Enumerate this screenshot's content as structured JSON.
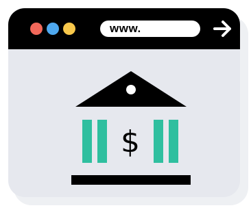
{
  "browser": {
    "url_text": "www.",
    "window_controls": [
      {
        "name": "close",
        "color": "#f2685a"
      },
      {
        "name": "minimize",
        "color": "#4fa9ef"
      },
      {
        "name": "maximize",
        "color": "#f8c84b"
      }
    ],
    "go_icon": "arrow-right-icon"
  },
  "content": {
    "icon": "bank-icon",
    "symbol": "$",
    "colors": {
      "frame": "#000000",
      "background": "#e6e8ee",
      "column": "#2fbf9f"
    }
  }
}
